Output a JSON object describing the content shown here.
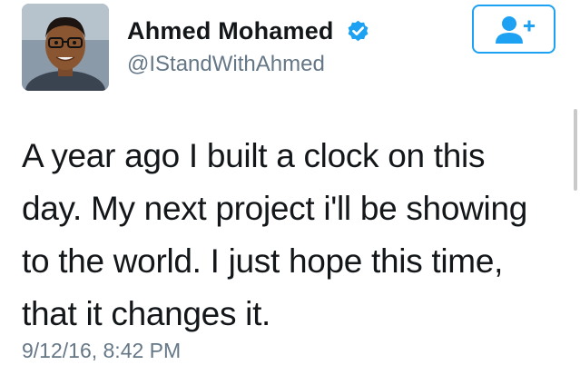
{
  "tweet": {
    "author": {
      "display_name": "Ahmed Mohamed",
      "handle": "@IStandWithAhmed",
      "verified": true,
      "avatar_icon": "profile-photo"
    },
    "follow_button": {
      "icon": "add-user-icon"
    },
    "text_lines": [
      "A year ago I built a clock on this",
      "day. My next project i'll be showing",
      "to the world. I just hope this time,",
      "that it changes it."
    ],
    "timestamp": "9/12/16, 8:42 PM"
  },
  "colors": {
    "accent": "#1da1f2",
    "text": "#14171a",
    "secondary_text": "#657786"
  }
}
